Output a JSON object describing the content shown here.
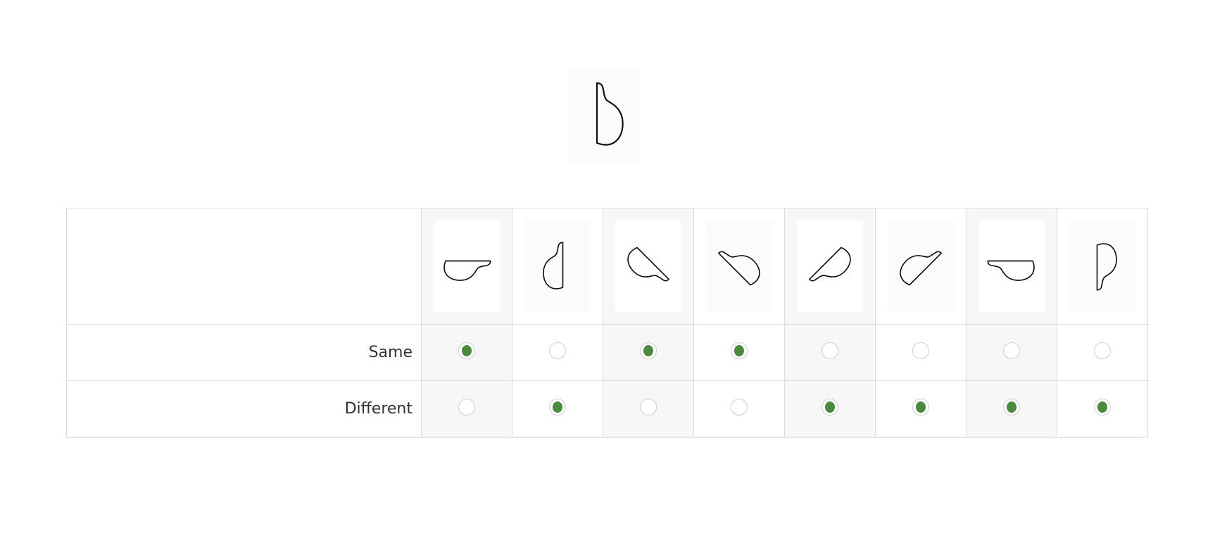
{
  "reference": {
    "icon": "shape-b-icon"
  },
  "options": [
    {
      "icon": "shape-rotated-90-icon",
      "rotation": 90,
      "mirrored": false,
      "shaded": true
    },
    {
      "icon": "shape-mirrored-icon",
      "rotation": 0,
      "mirrored": true,
      "shaded": false
    },
    {
      "icon": "shape-rotated-135-icon",
      "rotation": 135,
      "mirrored": false,
      "shaded": true
    },
    {
      "icon": "shape-rotated-315-icon",
      "rotation": 315,
      "mirrored": false,
      "shaded": false
    },
    {
      "icon": "shape-mirrored-rotated-icon",
      "rotation": 225,
      "mirrored": true,
      "shaded": true
    },
    {
      "icon": "shape-mirrored-rotated-icon",
      "rotation": 45,
      "mirrored": true,
      "shaded": false
    },
    {
      "icon": "shape-mirrored-rotated-icon",
      "rotation": 270,
      "mirrored": true,
      "shaded": true
    },
    {
      "icon": "shape-mirrored-rotated-icon",
      "rotation": 180,
      "mirrored": true,
      "shaded": false
    }
  ],
  "rows": [
    {
      "label": "Same",
      "selected": [
        true,
        false,
        true,
        true,
        false,
        false,
        false,
        false
      ]
    },
    {
      "label": "Different",
      "selected": [
        false,
        true,
        false,
        false,
        true,
        true,
        true,
        true
      ]
    }
  ],
  "colors": {
    "accent": "#4a8a3c",
    "border": "#dcdcdc",
    "shade": "#f7f7f7"
  }
}
